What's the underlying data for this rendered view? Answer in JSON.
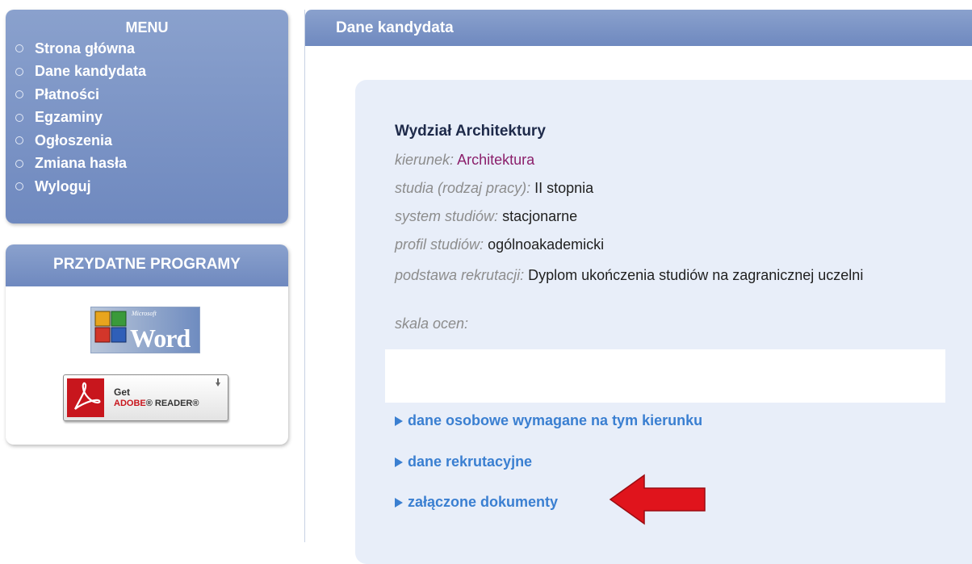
{
  "sidebar": {
    "menu": {
      "title": "MENU",
      "items": [
        {
          "label": "Strona główna"
        },
        {
          "label": "Dane kandydata"
        },
        {
          "label": "Płatności"
        },
        {
          "label": "Egzaminy"
        },
        {
          "label": "Ogłoszenia"
        },
        {
          "label": "Zmiana hasła"
        },
        {
          "label": "Wyloguj"
        }
      ]
    },
    "tools": {
      "title": "PRZYDATNE PROGRAMY",
      "word": {
        "brand_small": "Microsoft",
        "brand_large": "Word",
        "icon": "ms-word-icon"
      },
      "adobe": {
        "get": "Get",
        "brand": "ADOBE",
        "product": "READER",
        "icon": "adobe-pdf-icon"
      }
    }
  },
  "main": {
    "header": "Dane kandydata",
    "faculty": "Wydział Architektury",
    "fields": {
      "kierunek": {
        "label": "kierunek:",
        "value": "Architektura"
      },
      "studia": {
        "label": "studia (rodzaj pracy):",
        "value": "II stopnia"
      },
      "system": {
        "label": "system studiów:",
        "value": "stacjonarne"
      },
      "profil": {
        "label": "profil studiów:",
        "value": "ogólnoakademicki"
      },
      "podstawa": {
        "label": "podstawa rekrutacji:",
        "value": "Dyplom ukończenia studiów na zagranicznej uczelni"
      },
      "skala": {
        "label": "skala ocen:",
        "value": ""
      }
    },
    "links": [
      {
        "label": "dane osobowe wymagane na tym kierunku"
      },
      {
        "label": "dane rekrutacyjne"
      },
      {
        "label": "załączone dokumenty"
      }
    ]
  },
  "colors": {
    "panel_blue": "#7d95c7",
    "card_bg": "#e8eef9",
    "link_blue": "#3a7fd1",
    "accent_value": "#8b1f6b",
    "annotation_red": "#e0141c"
  }
}
